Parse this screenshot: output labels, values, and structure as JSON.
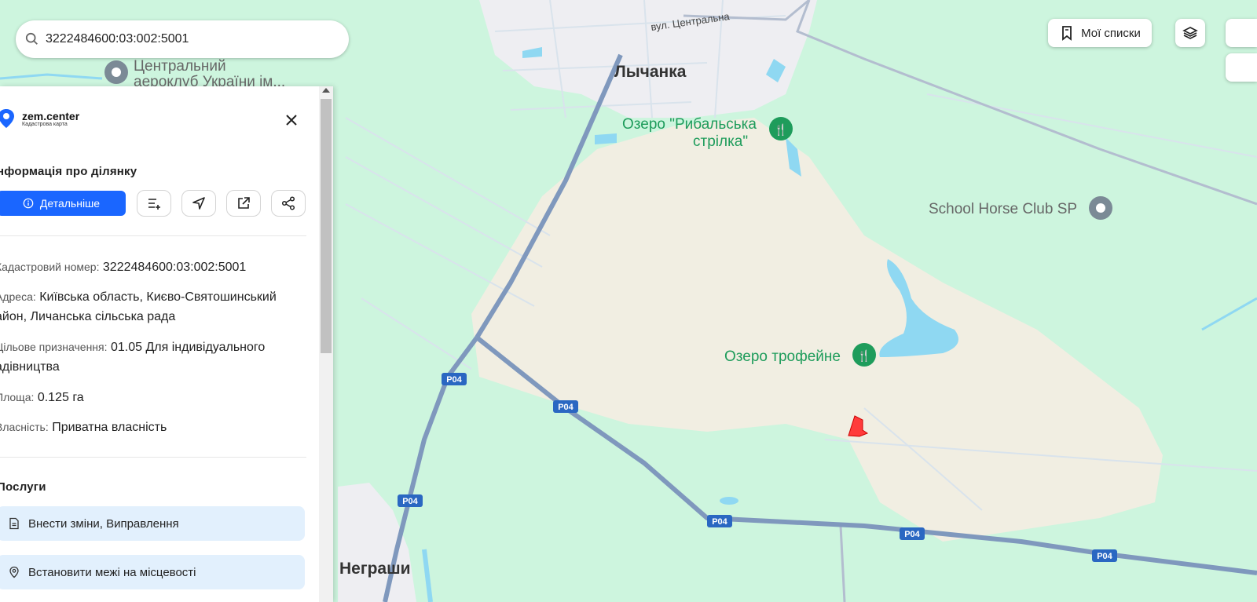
{
  "search": {
    "value": "3222484600:03:002:5001",
    "icon": "search-icon"
  },
  "top_buttons": {
    "my_lists": "Мої списки",
    "layers_icon": "layers-icon"
  },
  "map_labels": {
    "town_lychanka": "Лычанка",
    "town_nehrashi": "Неграши",
    "street_central": "вул. Центральна",
    "poi_aeroclub_line1": "Центральний",
    "poi_aeroclub_line2": "аероклуб України ім...",
    "poi_lake_rybalska_line1": "Озеро \"Рибальська",
    "poi_lake_rybalska_line2": "стрілка\"",
    "poi_horse_club": "School Horse Club SP",
    "poi_lake_trofeine": "Озеро трофейне",
    "road_shield": "Р04"
  },
  "panel": {
    "brand": "zem.center",
    "brand_sub": "Кадастрова карта",
    "title": "нформація про ділянку",
    "details_button": "Детальніше",
    "actions": [
      "list-add-icon",
      "navigate-icon",
      "external-link-icon",
      "share-icon"
    ],
    "fields": {
      "cadastral_label": "Кадастровий номер:",
      "cadastral_value": "3222484600:03:002:5001",
      "address_label": "Адреса:",
      "address_value_line1": "Київська область, Києво-Святошинський",
      "address_value_line2": "айон, Личанська сільська рада",
      "purpose_label": "Цільове призначення:",
      "purpose_value_line1": "01.05 Для індивідуального",
      "purpose_value_line2": "адівництва",
      "area_label": "Площа:",
      "area_value": "0.125 га",
      "ownership_label": "Власність:",
      "ownership_value": "Приватна власність"
    },
    "services_title": "Послуги",
    "services": [
      "Внести зміни, Виправлення",
      "Встановити межі на місцевості"
    ]
  },
  "colors": {
    "map_bg": "#cdf5de",
    "farmland": "#f1eee2",
    "town": "#eeeef2",
    "water": "#8fd8f2",
    "major_road": "#7f98bd",
    "minor_road": "#b3bdcf",
    "poi_green": "#1e9c5b",
    "accent": "#1a66ff",
    "parcel": "#ff3b3b"
  }
}
